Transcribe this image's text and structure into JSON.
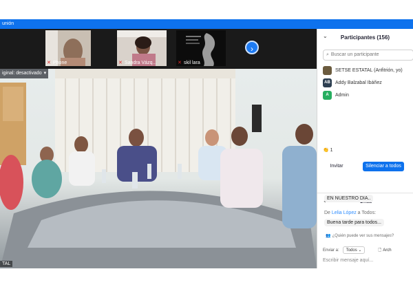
{
  "window": {
    "title_fragment": "unión"
  },
  "thumbnails": [
    {
      "name": "Phone",
      "muted": true
    },
    {
      "name": "Sandra Vázq...",
      "muted": true
    },
    {
      "name": "skil lara",
      "muted": true
    }
  ],
  "main_video": {
    "top_badge_label": "iginal: desactivado",
    "bottom_name": "TAL"
  },
  "participants_panel": {
    "title": "Participantes (156)",
    "search_placeholder": "Buscar un participante",
    "participants": [
      {
        "name": "SETSE ESTATAL (Anfitrión, yo)",
        "initials": "",
        "color": "#6b5b3e"
      },
      {
        "name": "Addy Balzabal Ibáñez",
        "initials": "AB",
        "color": "#2c3e50"
      },
      {
        "name": "Admin",
        "initials": "A",
        "color": "#27ae60"
      }
    ],
    "reaction_count": "1",
    "invite_label": "Invitar",
    "mute_all_label": "Silenciar a todos"
  },
  "chat": {
    "title": "Chat",
    "messages": [
      {
        "text": "EN NUESTRO DIA..",
        "from_prefix": "",
        "sender": "",
        "from_suffix": ""
      },
      {
        "text": "Buena tarde para todos...",
        "from_prefix": "De",
        "sender": "Lelia López",
        "from_suffix": "a Todos:"
      }
    ],
    "who_sees_label": "¿Quién puede ver sus mensajes?",
    "send_to_label": "Enviar a:",
    "send_target": "Todos",
    "file_label": "Arch",
    "input_placeholder": "Escribir mensaje aquí..."
  },
  "colors": {
    "accent": "#0e72ed",
    "titlebar": "#0e72ed",
    "mic_muted": "#e02828"
  }
}
